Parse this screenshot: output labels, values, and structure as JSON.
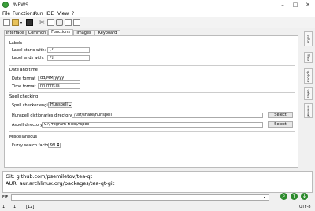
{
  "window": {
    "title": "./NEWS"
  },
  "menu": [
    "File",
    "Functions",
    "Run",
    "IDE",
    "View",
    "?"
  ],
  "toolbar": {
    "icons": [
      "new-file-icon",
      "open-file-icon",
      "save-icon",
      "cut-icon",
      "copy-icon",
      "paste-icon",
      "undo-icon",
      "redo-icon"
    ]
  },
  "tabs": [
    "Interface",
    "Common",
    "Functions",
    "Images",
    "Keyboard"
  ],
  "active_tab": "Functions",
  "labels_section": {
    "title": "Labels",
    "starts_label": "Label starts with:",
    "starts_value": "[?",
    "ends_label": "Label ends with:",
    "ends_value": "?]"
  },
  "datetime_section": {
    "title": "Date and time",
    "date_label": "Date format",
    "date_value": "dd/MM/yyyy",
    "time_label": "Time format",
    "time_value": "hh:mm:ss"
  },
  "spell_section": {
    "title": "Spell checking",
    "engine_label": "Spell checker engine",
    "engine_value": "Hunspell",
    "hunspell_label": "Hunspell dictionaries directory",
    "hunspell_value": "/usr/share/hunspell",
    "aspell_label": "Aspell directory",
    "aspell_value": "C:\\Program Files\\Aspell",
    "select_label": "Select"
  },
  "misc_section": {
    "title": "Miscellaneous",
    "fuzzy_label": "Fuzzy search factor",
    "fuzzy_value": "60"
  },
  "side_tabs": [
    "editor",
    "files",
    "options",
    "dates",
    "manual"
  ],
  "log": [
    "Git: github.com/psemiletov/tea-qt",
    "AUR: aur.archlinux.org/packages/tea-qt-git"
  ],
  "fif": {
    "label": "FIF",
    "value": ""
  },
  "status": {
    "line": "1",
    "col": "1",
    "count": "[12]",
    "encoding": "UTF-8"
  },
  "colors": {
    "accent": "#2c8a2c"
  }
}
